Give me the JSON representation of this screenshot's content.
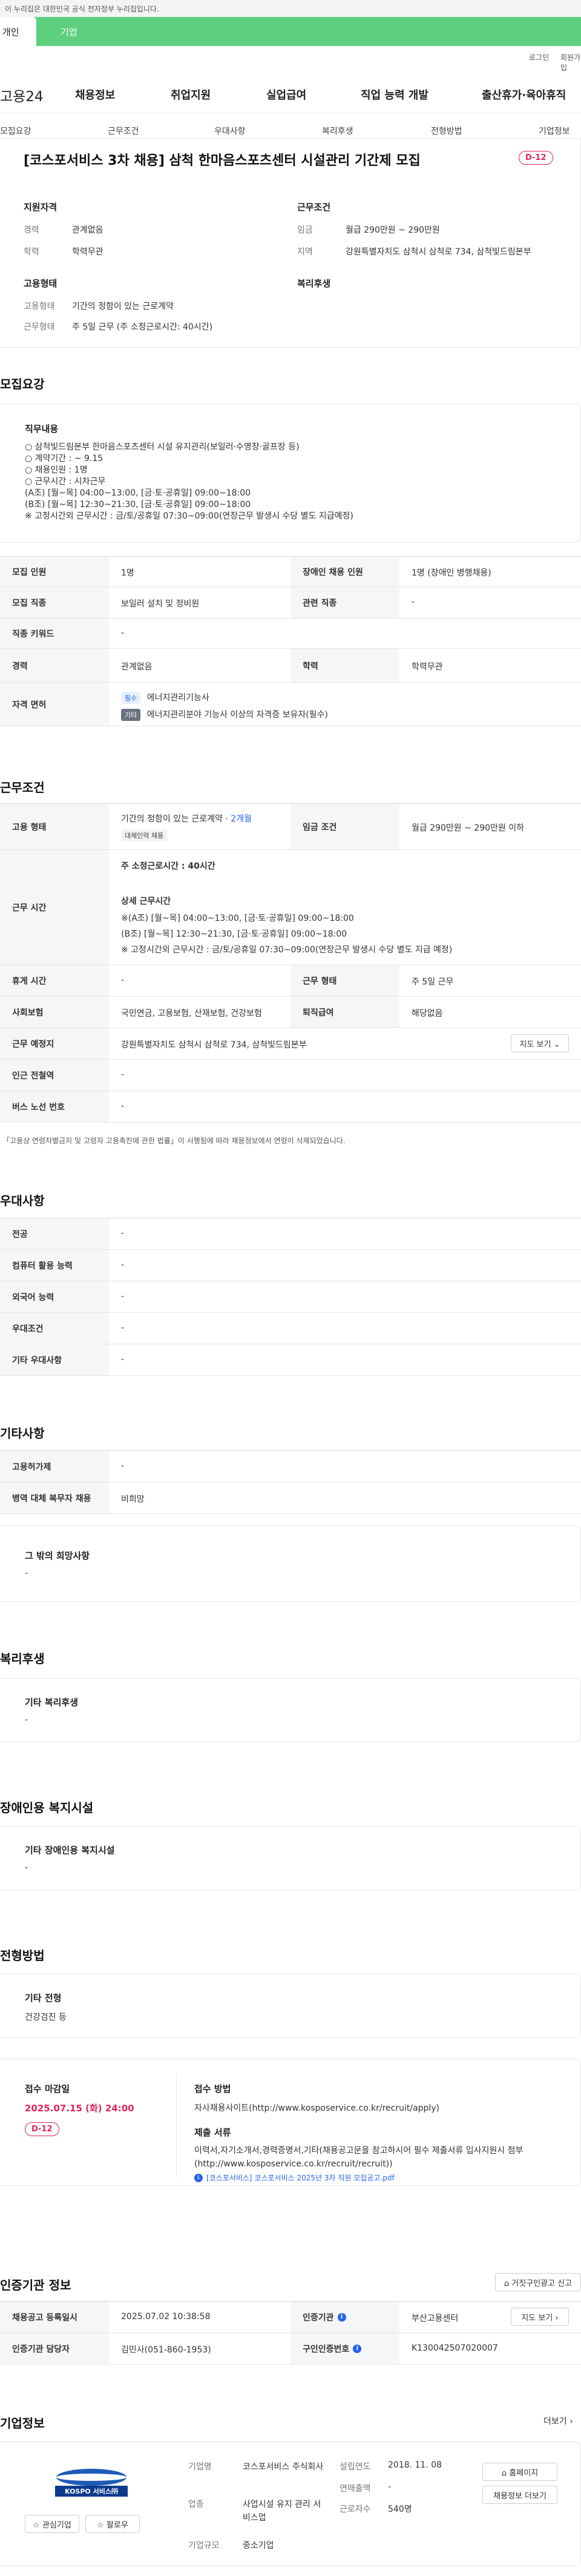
{
  "gov_notice": "이 누리집은 대한민국 공식 전자정부 누리집입니다.",
  "top_tabs": {
    "individual": "개인",
    "company": "기업"
  },
  "util": {
    "login": "로그인",
    "signup": "회원가입"
  },
  "logo": "고용24",
  "gnb": [
    "채용정보",
    "취업지원",
    "실업급여",
    "직업 능력 개발",
    "출산휴가·육아휴직"
  ],
  "snb": [
    "모집요강",
    "근무조건",
    "우대사항",
    "복리후생",
    "전형방법",
    "기업정보"
  ],
  "header": {
    "title": "[코스포서비스 3차 채용] 삼척 한마음스포츠센터 시설관리 기간제 모집",
    "dday": "D-12",
    "qual_title": "지원자격",
    "career_label": "경력",
    "career_value": "관계없음",
    "edu_label": "학력",
    "edu_value": "학력무관",
    "cond_title": "근무조건",
    "wage_label": "임금",
    "wage_value": "월급 290만원 ~ 290만원",
    "area_label": "지역",
    "area_value": "강원특별자치도 삼척시 삼척로 734, 삼척빛드림본부",
    "emp_title": "고용형태",
    "emp_type_label": "고용형태",
    "emp_type_value": "기간의 정함이 있는 근로계약",
    "work_label": "근무형태",
    "work_value": "주 5일 근무 (주 소정근로시간: 40시간)",
    "welfare_title": "복리후생"
  },
  "recruit": {
    "section_title": "모집요강",
    "duty_title": "직무내용",
    "duty_text": "○ 삼척빛드림본부 한마음스포츠센터 시설 유지관리(보일러·수영장·골프장 등)\n○ 계약기간 : ~ 9.15\n○ 채용인원 : 1명\n○ 근무시간 : 시차근무\n   (A조) [월~목] 04:00~13:00, [금·토·공휴일] 09:00~18:00\n   (B조) [월~목] 12:30~21:30, [금·토·공휴일] 09:00~18:00\n   ※ 고정시간외 근무시간 : 금/토/공휴일 07:30~09:00(연장근무 발생시 수당 별도 지급예정)",
    "rows": {
      "count_label": "모집 인원",
      "count_value": "1명",
      "disabled_label": "장애인 채용 인원",
      "disabled_value": "1명 (장애인 병행채용)",
      "job_label": "모집 직종",
      "job_value": "보일러 설치 및 정비원",
      "related_label": "관련 직종",
      "related_value": "-",
      "keyword_label": "직종 키워드",
      "keyword_value": "-",
      "career_label": "경력",
      "career_value": "관계없음",
      "edu_label": "학력",
      "edu_value": "학력무관",
      "license_label": "자격 면허",
      "license_chip1": "필수",
      "license1": "에너지관리기능사",
      "license_chip2": "기타",
      "license2": "에너지관리분야 기능사 이상의 자격증 보유자(필수)"
    }
  },
  "conditions": {
    "section_title": "근무조건",
    "emp_label": "고용 형태",
    "emp_value": "기간의 정함이 있는 근로계약 · ",
    "emp_months": "2개월",
    "emp_chip": "대체인력 채용",
    "wage_label": "임금 조건",
    "wage_value": "월급 290만원 ~ 290만원 이하",
    "time_label": "근무 시간",
    "time_week": "주 소정근로시간 : 40시간",
    "time_detail_title": "상세 근무시간",
    "time_detail": "※(A조) [월~목] 04:00~13:00, [금·토·공휴일] 09:00~18:00\n  (B조) [월~목] 12:30~21:30, [금·토·공휴일] 09:00~18:00\n※ 고정시간외 근무시간 : 금/토/공휴일 07:30~09:00(연장근무 발생시 수당 별도 지급 예정)",
    "rest_label": "휴게 시간",
    "rest_value": "-",
    "worktype_label": "근무 형태",
    "worktype_value": "주 5일 근무",
    "insurance_label": "사회보험",
    "insurance_value": "국민연금, 고용보험, 산재보험, 건강보험",
    "severance_label": "퇴직급여",
    "severance_value": "해당없음",
    "place_label": "근무 예정지",
    "place_value": "강원특별자치도 삼척시 삼척로 734, 삼척빛드림본부",
    "map_btn": "지도 보기",
    "subway_label": "인근 전철역",
    "subway_value": "-",
    "bus_label": "버스 노선 번호",
    "bus_value": "-",
    "notice": "「고용상 연령차별금지 및 고령자 고용촉진에 관한 법률」이 시행됨에 따라 채용정보에서 연령이 삭제되었습니다."
  },
  "preference": {
    "section_title": "우대사항",
    "rows": [
      {
        "label": "전공",
        "value": "-"
      },
      {
        "label": "컴퓨터 활용 능력",
        "value": "-"
      },
      {
        "label": "외국어 능력",
        "value": "-"
      },
      {
        "label": "우대조건",
        "value": "-"
      },
      {
        "label": "기타 우대사항",
        "value": "-"
      }
    ]
  },
  "etc": {
    "section_title": "기타사항",
    "employment_label": "고용허가제",
    "employment_value": "-",
    "military_label": "병역 대체 복무자 채용",
    "military_value": "비희망",
    "other_title": "그 밖의 희망사항",
    "other_value": "-"
  },
  "welfare": {
    "section_title": "복리후생",
    "box_title": "기타 복리후생",
    "box_value": "-"
  },
  "disability": {
    "section_title": "장애인용 복지시설",
    "box_title": "기타 장애인용 복지시설",
    "box_value": "-"
  },
  "selection": {
    "section_title": "전형방법",
    "box_title": "기타 전형",
    "box_value": "건강검진 등"
  },
  "apply": {
    "deadline_title": "접수 마감일",
    "deadline": "2025.07.15 (화) 24:00",
    "dday": "D-12",
    "method_title": "접수 방법",
    "method_value": "자사채용사이트(http://www.kosposervice.co.kr/recruit/apply)",
    "docs_title": "제출 서류",
    "docs_value": "이력서,자기소개서,경력증명서,기타(채용공고문을 참고하시어 필수 제출서류 입사지원시 첨부 (http://www.kosposervice.co.kr/recruit/recruit))",
    "attachment": "[코스포서비스] 코스포서비스 2025년 3차 직원 모집공고.pdf"
  },
  "agency": {
    "section_title": "인증기관 정보",
    "report_btn": "거짓구인광고 신고",
    "reg_label": "채용공고 등록일시",
    "reg_value": "2025.07.02 10:38:58",
    "agency_label": "인증기관",
    "agency_value": "부산고용센터",
    "map_btn": "지도 보기",
    "manager_label": "인증기관 담당자",
    "manager_value": "김민사(051-860-1953)",
    "num_label": "구인인증번호",
    "num_value": "K130042507020007"
  },
  "company": {
    "section_title": "기업정보",
    "more": "더보기",
    "logo_text": "KOSPO 서비스㈜",
    "fav_btn": "관심기업",
    "follow_btn": "팔로우",
    "name_label": "기업명",
    "name_value": "코스포서비스 주식회사",
    "founded_label": "설립연도",
    "founded_value": "2018. 11. 08",
    "industry_label": "업종",
    "industry_value": "사업시설 유지 관리 서비스업",
    "revenue_label": "연매출액",
    "revenue_value": "-",
    "staff_label": "근로자수",
    "staff_value": "540명",
    "size_label": "기업규모",
    "size_value": "중소기업",
    "homepage_btn": "홈페이지",
    "jobs_btn": "채용정보 더보기"
  },
  "colors": {
    "green": "#5ecf7e",
    "accent": "#e0245e",
    "blue": "#2563eb"
  }
}
